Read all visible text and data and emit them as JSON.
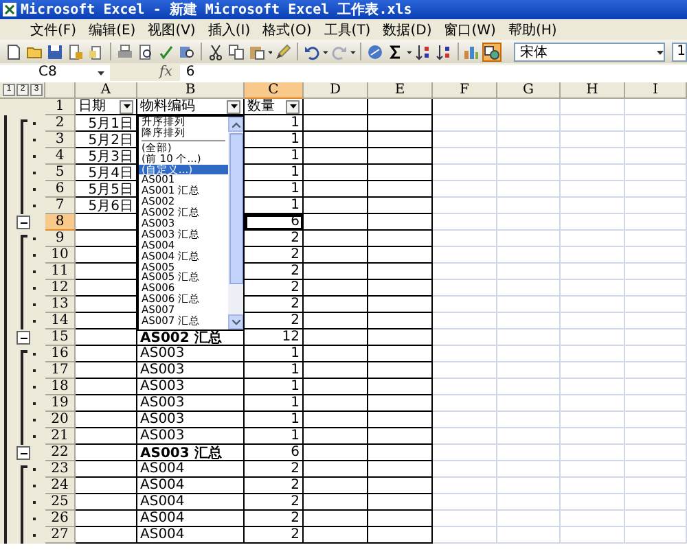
{
  "window": {
    "title": "Microsoft Excel - 新建 Microsoft Excel 工作表.xls"
  },
  "menu": [
    "文件(F)",
    "编辑(E)",
    "视图(V)",
    "插入(I)",
    "格式(O)",
    "工具(T)",
    "数据(D)",
    "窗口(W)",
    "帮助(H)"
  ],
  "toolbar": {
    "buttons": [
      {
        "kind": "new",
        "on": false
      },
      {
        "kind": "open",
        "on": false
      },
      {
        "kind": "save",
        "on": false
      },
      {
        "kind": "permission",
        "on": false
      },
      {
        "kind": "mail",
        "on": false
      },
      {
        "kind": "sep"
      },
      {
        "kind": "print",
        "on": false
      },
      {
        "kind": "preview",
        "on": false
      },
      {
        "kind": "spell",
        "on": false
      },
      {
        "kind": "research",
        "on": false
      },
      {
        "kind": "sep"
      },
      {
        "kind": "cut",
        "on": false
      },
      {
        "kind": "copy",
        "on": false
      },
      {
        "kind": "paste",
        "on": false
      },
      {
        "kind": "caret"
      },
      {
        "kind": "painter",
        "on": false
      },
      {
        "kind": "sep"
      },
      {
        "kind": "undo",
        "on": false
      },
      {
        "kind": "caret"
      },
      {
        "kind": "redo",
        "on": false
      },
      {
        "kind": "caret"
      },
      {
        "kind": "sep"
      },
      {
        "kind": "link",
        "on": false
      },
      {
        "kind": "sum",
        "on": false
      },
      {
        "kind": "caret"
      },
      {
        "kind": "sortasc",
        "on": false
      },
      {
        "kind": "sortdesc",
        "on": false
      },
      {
        "kind": "sep"
      },
      {
        "kind": "chart",
        "on": false
      },
      {
        "kind": "drawing",
        "on": true
      }
    ],
    "font": "宋体",
    "font_size": "1"
  },
  "formula_bar": {
    "name_box": "C8",
    "fx": "fx",
    "value": "6"
  },
  "outline_levels": [
    "1",
    "2",
    "3"
  ],
  "columns": [
    {
      "label": "A",
      "selected": false
    },
    {
      "label": "B",
      "selected": false
    },
    {
      "label": "C",
      "selected": true
    },
    {
      "label": "D",
      "selected": false
    },
    {
      "label": "E",
      "selected": false
    },
    {
      "label": "F",
      "selected": false
    },
    {
      "label": "G",
      "selected": false
    },
    {
      "label": "H",
      "selected": false
    },
    {
      "label": "I",
      "selected": false
    }
  ],
  "rows": [
    {
      "num": "1",
      "kind": "header",
      "selected": false,
      "a": "日期",
      "b": "物料编码",
      "c": "数量"
    },
    {
      "num": "2",
      "kind": "detail",
      "selected": false,
      "a": "5月1日",
      "c": "1"
    },
    {
      "num": "3",
      "kind": "detail",
      "selected": false,
      "a": "5月2日",
      "c": "1"
    },
    {
      "num": "4",
      "kind": "detail",
      "selected": false,
      "a": "5月3日",
      "c": "1"
    },
    {
      "num": "5",
      "kind": "detail",
      "selected": false,
      "a": "5月4日",
      "c": "1"
    },
    {
      "num": "6",
      "kind": "detail",
      "selected": false,
      "a": "5月5日",
      "c": "1"
    },
    {
      "num": "7",
      "kind": "detail",
      "selected": false,
      "a": "5月6日",
      "c": "1"
    },
    {
      "num": "8",
      "kind": "summary",
      "selected": true,
      "c": "6"
    },
    {
      "num": "9",
      "kind": "detail",
      "selected": false,
      "c": "2"
    },
    {
      "num": "10",
      "kind": "detail",
      "selected": false,
      "c": "2"
    },
    {
      "num": "11",
      "kind": "detail",
      "selected": false,
      "c": "2"
    },
    {
      "num": "12",
      "kind": "detail",
      "selected": false,
      "c": "2"
    },
    {
      "num": "13",
      "kind": "detail",
      "selected": false,
      "c": "2"
    },
    {
      "num": "14",
      "kind": "detail",
      "selected": false,
      "c": "2"
    },
    {
      "num": "15",
      "kind": "summary",
      "selected": false,
      "b": "AS002 汇总",
      "c": "12"
    },
    {
      "num": "16",
      "kind": "detail",
      "selected": false,
      "b": "AS003",
      "c": "1"
    },
    {
      "num": "17",
      "kind": "detail",
      "selected": false,
      "b": "AS003",
      "c": "1"
    },
    {
      "num": "18",
      "kind": "detail",
      "selected": false,
      "b": "AS003",
      "c": "1"
    },
    {
      "num": "19",
      "kind": "detail",
      "selected": false,
      "b": "AS003",
      "c": "1"
    },
    {
      "num": "20",
      "kind": "detail",
      "selected": false,
      "b": "AS003",
      "c": "1"
    },
    {
      "num": "21",
      "kind": "detail",
      "selected": false,
      "b": "AS003",
      "c": "1"
    },
    {
      "num": "22",
      "kind": "summary",
      "selected": false,
      "b": "AS003 汇总",
      "c": "6"
    },
    {
      "num": "23",
      "kind": "detail",
      "selected": false,
      "b": "AS004",
      "c": "2"
    },
    {
      "num": "24",
      "kind": "detail",
      "selected": false,
      "b": "AS004",
      "c": "2"
    },
    {
      "num": "25",
      "kind": "detail",
      "selected": false,
      "b": "AS004",
      "c": "2"
    },
    {
      "num": "26",
      "kind": "detail",
      "selected": false,
      "b": "AS004",
      "c": "2"
    },
    {
      "num": "27",
      "kind": "detail",
      "selected": false,
      "b": "AS004",
      "c": "2"
    }
  ],
  "filter_list": {
    "sort": [
      "升序排列",
      "降序排列"
    ],
    "items": [
      {
        "label": "(全部)",
        "selected": false
      },
      {
        "label": "(前 10 个...)",
        "selected": false
      },
      {
        "label": "(自定义...)",
        "selected": true
      },
      {
        "label": "AS001",
        "selected": false
      },
      {
        "label": "AS001 汇总",
        "selected": false
      },
      {
        "label": "AS002",
        "selected": false
      },
      {
        "label": "AS002 汇总",
        "selected": false
      },
      {
        "label": "AS003",
        "selected": false
      },
      {
        "label": "AS003 汇总",
        "selected": false
      },
      {
        "label": "AS004",
        "selected": false
      },
      {
        "label": "AS004 汇总",
        "selected": false
      },
      {
        "label": "AS005",
        "selected": false
      },
      {
        "label": "AS005 汇总",
        "selected": false
      },
      {
        "label": "AS006",
        "selected": false
      },
      {
        "label": "AS006 汇总",
        "selected": false
      },
      {
        "label": "AS007",
        "selected": false
      },
      {
        "label": "AS007 汇总",
        "selected": false
      }
    ]
  }
}
